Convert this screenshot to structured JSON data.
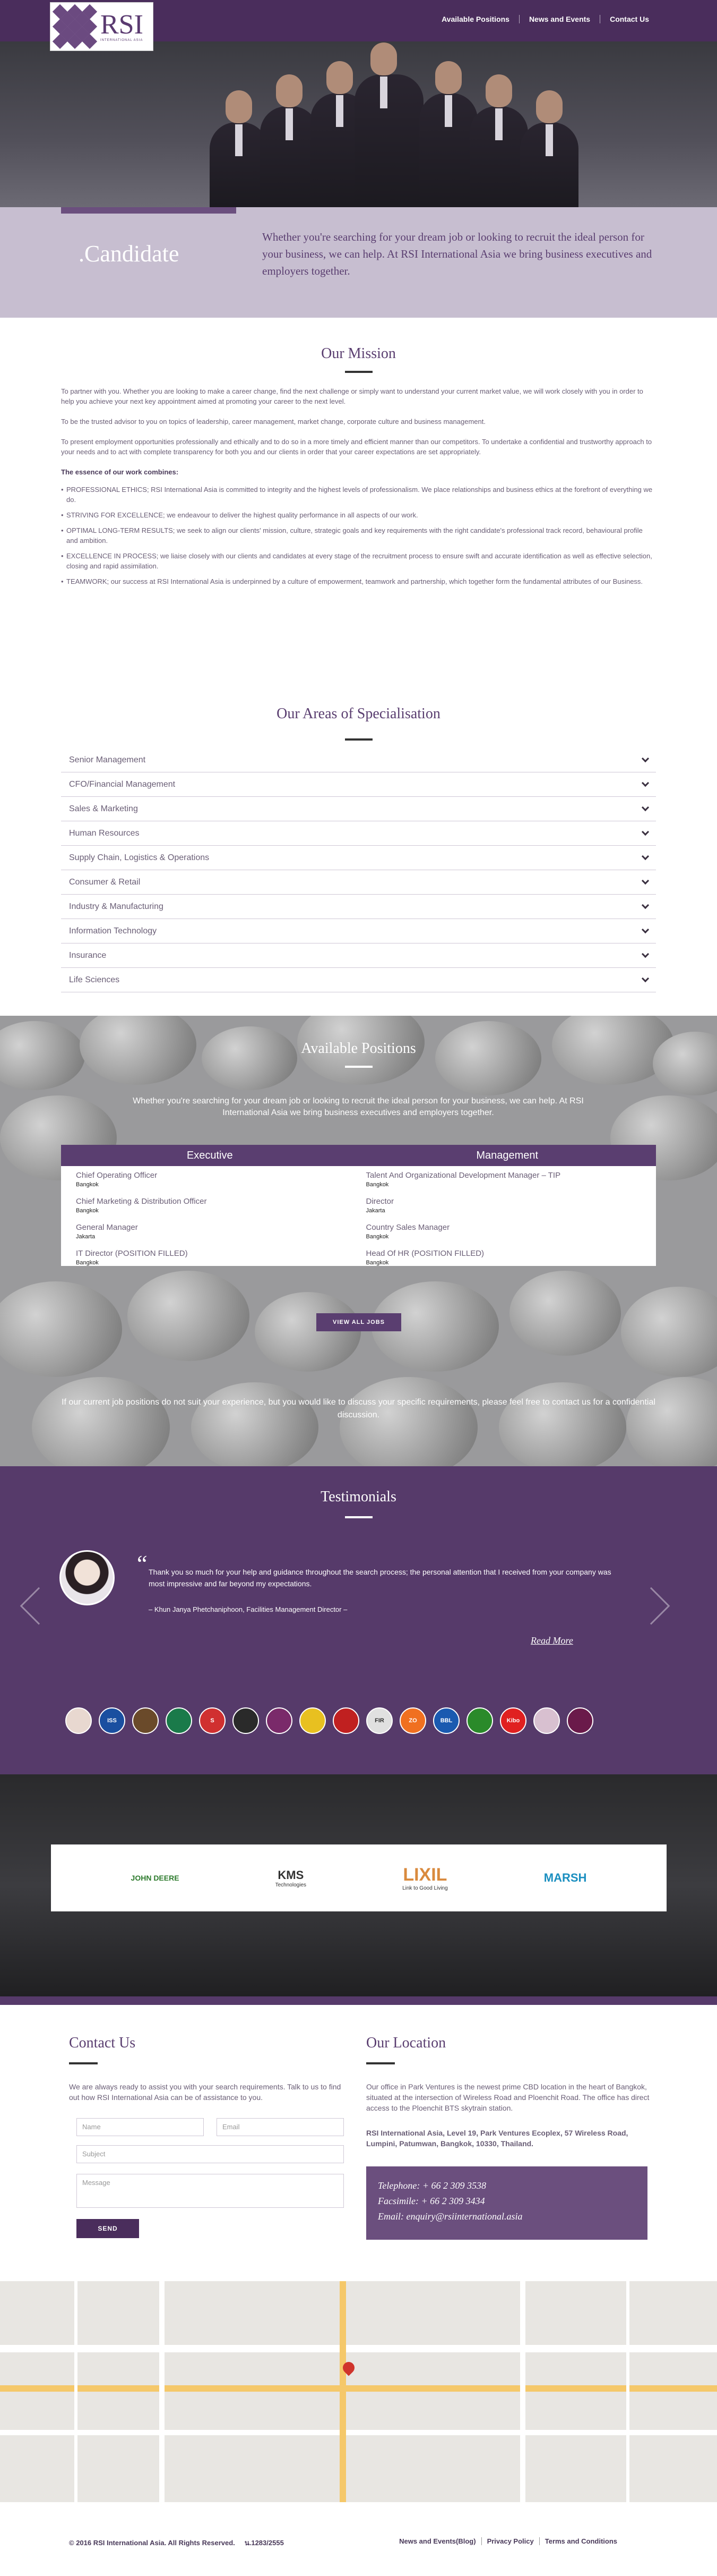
{
  "header": {
    "logo_text": "RSI",
    "logo_sub": "INTERNATIONAL ASIA",
    "nav": [
      "Available Positions",
      "News and Events",
      "Contact Us"
    ]
  },
  "hero": {
    "title": ".Candidate",
    "text": "Whether you're searching for your dream job or looking to recruit the ideal person for your business, we can help. At RSI International Asia we bring business executives and employers together."
  },
  "mission": {
    "title": "Our Mission",
    "p1": "To partner with you. Whether you are looking to make a career change, find the next challenge or simply want to understand your current market value, we will work closely with you in order to help you achieve your next key appointment aimed at promoting your career to the next level.",
    "p2": "To be the trusted advisor to you on topics of leadership, career management, market change, corporate culture and business management.",
    "p3": "To present employment opportunities professionally and ethically and to do so in a more timely and efficient manner than our competitors. To undertake a confidential and trustworthy approach to your needs and to act with complete transparency for both you and our clients in order that your career expectations are set appropriately.",
    "essence": "The essence of our work combines:",
    "items": [
      "PROFESSIONAL ETHICS; RSI International Asia is committed to integrity and the highest levels of professionalism. We place relationships and business ethics at the forefront of everything we do.",
      "STRIVING FOR EXCELLENCE; we endeavour to deliver the highest quality performance in all aspects of our work.",
      "OPTIMAL LONG-TERM RESULTS; we seek to align our clients' mission, culture, strategic goals and key requirements with the right candidate's professional track record, behavioural profile and ambition.",
      "EXCELLENCE IN PROCESS; we liaise closely with our clients and candidates at every stage of the recruitment process to ensure swift and accurate identification as well as effective selection, closing and rapid assimilation.",
      "TEAMWORK; our success at RSI International Asia is underpinned by a culture of empowerment, teamwork and partnership, which together form the fundamental attributes of our Business."
    ]
  },
  "specialisation": {
    "title": "Our Areas of Specialisation",
    "items": [
      "Senior Management",
      "CFO/Financial Management",
      "Sales & Marketing",
      "Human Resources",
      "Supply Chain, Logistics & Operations",
      "Consumer & Retail",
      "Industry & Manufacturing",
      "Information Technology",
      "Insurance",
      "Life Sciences"
    ]
  },
  "positions": {
    "title": "Available Positions",
    "intro": "Whether you're searching for your dream job or looking to recruit the ideal person for your business, we can help. At RSI International Asia we bring business executives and employers together.",
    "executive_label": "Executive",
    "management_label": "Management",
    "executive": [
      {
        "title": "Chief Operating Officer",
        "loc": "Bangkok"
      },
      {
        "title": "Chief Marketing & Distribution Officer",
        "loc": "Bangkok"
      },
      {
        "title": "General Manager",
        "loc": "Jakarta"
      },
      {
        "title": "IT Director (POSITION FILLED)",
        "loc": "Bangkok"
      }
    ],
    "management": [
      {
        "title": "Talent And Organizational Development Manager – TIP",
        "loc": "Bangkok"
      },
      {
        "title": "Director",
        "loc": "Jakarta"
      },
      {
        "title": "Country Sales Manager",
        "loc": "Bangkok"
      },
      {
        "title": "Head Of HR (POSITION FILLED)",
        "loc": "Bangkok"
      }
    ],
    "button": "VIEW ALL JOBS",
    "outro": "If our current job positions do not suit your experience, but you would like to discuss your specific requirements, please feel free to contact us for a confidential discussion."
  },
  "testimonials": {
    "title": "Testimonials",
    "quote": "Thank you so much for your help and guidance throughout the search process; the personal attention that I received from your company was most impressive and far beyond my expectations.",
    "author": "– Khun Janya Phetchaniphoon, Facilities Management Director –",
    "read_more": "Read More",
    "clients": [
      "",
      "ISS",
      "",
      "",
      "S",
      "",
      "",
      "",
      "",
      "FIR",
      "ZO",
      "BBL",
      "",
      "Kibo",
      "",
      ""
    ]
  },
  "partners": [
    {
      "name": "JOHN DEERE",
      "sub": "",
      "color": "#2c7a2c"
    },
    {
      "name": "KMS",
      "sub": "Technologies",
      "color": "#333333"
    },
    {
      "name": "LIXIL",
      "sub": "Link to Good Living",
      "color": "#d98a3e"
    },
    {
      "name": "MARSH",
      "sub": "",
      "color": "#1b8fc0"
    }
  ],
  "contact": {
    "title": "Contact Us",
    "text": "We are always ready to assist you with your search requirements. Talk to us to find out how RSI International Asia can be of assistance to you.",
    "name_ph": "Name",
    "email_ph": "Email",
    "subject_ph": "Subject",
    "message_ph": "Message",
    "send": "SEND"
  },
  "location": {
    "title": "Our Location",
    "text": "Our office in Park Ventures is the newest prime CBD location in the heart of Bangkok, situated at the intersection of Wireless Road and Ploenchit Road. The office has direct access to the Ploenchit BTS skytrain station.",
    "address": "RSI International Asia, Level 19, Park Ventures Ecoplex, 57 Wireless Road, Lumpini, Patumwan, Bangkok, 10330, Thailand.",
    "phone": "Telephone: + 66 2 309 3538",
    "fax": "Facsimile: + 66 2 309 3434",
    "email": "Email: enquiry@rsiinternational.asia"
  },
  "footer": {
    "copyright": "© 2016 RSI International Asia. All Rights Reserved.",
    "license": "น.1283/2555",
    "links": [
      "News and Events(Blog)",
      "Privacy Policy",
      "Terms and Conditions"
    ]
  },
  "colors": {
    "brand": "#4a2d5c",
    "accent": "#6b4f7e",
    "band": "#c7bed0"
  }
}
